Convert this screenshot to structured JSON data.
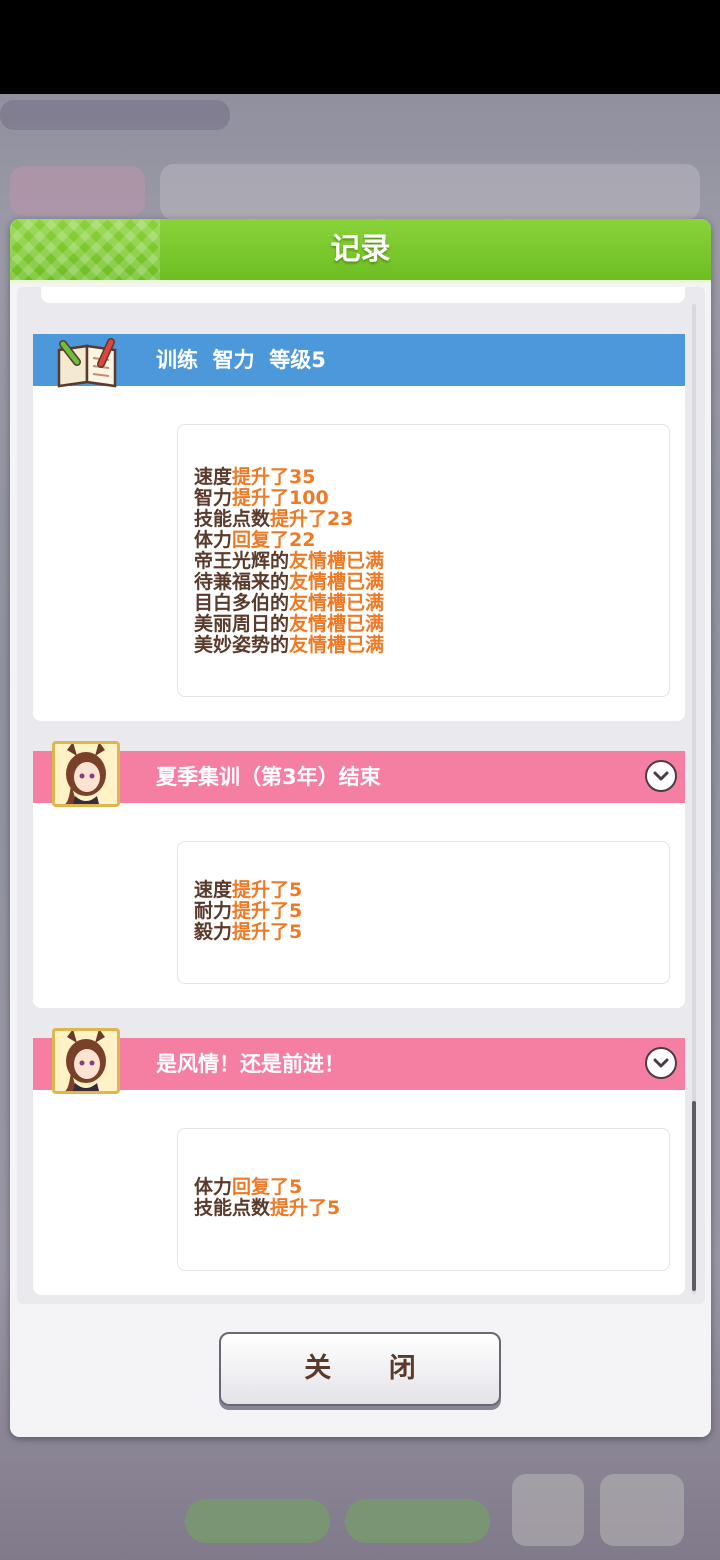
{
  "modal": {
    "title": "记录",
    "close_label": "关 闭"
  },
  "cards": [
    {
      "type": "training",
      "title": "训练  智力  等级5",
      "lines": [
        {
          "subject": "速度",
          "effect": "提升了35"
        },
        {
          "subject": "智力",
          "effect": "提升了100"
        },
        {
          "subject": "技能点数",
          "effect": "提升了23"
        },
        {
          "subject": "体力",
          "effect": "回复了22"
        },
        {
          "subject": "帝王光辉的",
          "effect": "友情槽已满"
        },
        {
          "subject": "待兼福来的",
          "effect": "友情槽已满"
        },
        {
          "subject": "目白多伯的",
          "effect": "友情槽已满"
        },
        {
          "subject": "美丽周日的",
          "effect": "友情槽已满"
        },
        {
          "subject": "美妙姿势的",
          "effect": "友情槽已满"
        }
      ]
    },
    {
      "type": "event",
      "title": "夏季集训（第3年）结束",
      "lines": [
        {
          "subject": "速度",
          "effect": "提升了5"
        },
        {
          "subject": "耐力",
          "effect": "提升了5"
        },
        {
          "subject": "毅力",
          "effect": "提升了5"
        }
      ]
    },
    {
      "type": "event",
      "title": "是风情！还是前进！",
      "lines": [
        {
          "subject": "体力",
          "effect": "回复了5"
        },
        {
          "subject": "技能点数",
          "effect": "提升了5"
        }
      ]
    }
  ],
  "icons": {
    "training": "notebook-pencil-icon",
    "event": "character-portrait",
    "expand": "chevron-down-icon"
  },
  "colors": {
    "header_green": "#7cc92e",
    "training_blue": "#4d97db",
    "event_pink": "#f57fa3",
    "highlight_orange": "#ee7a25",
    "text_brown": "#5a3a2a"
  }
}
